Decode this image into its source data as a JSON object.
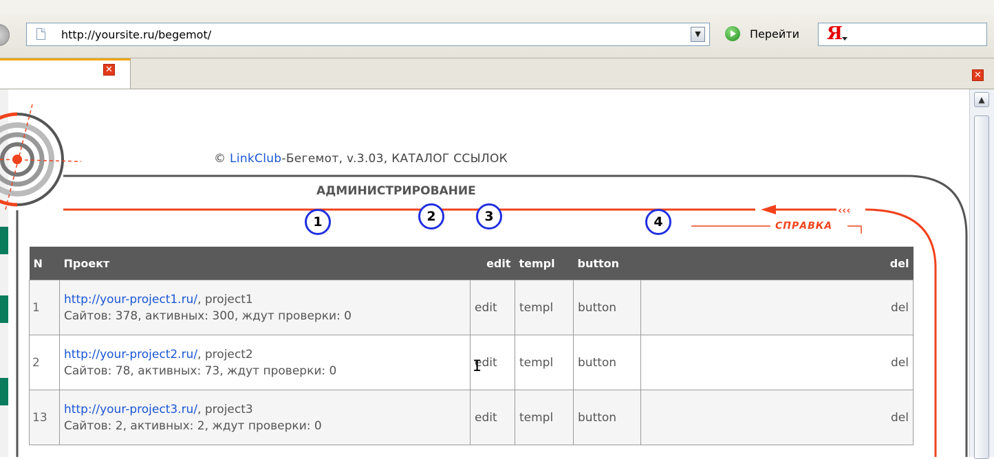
{
  "browser": {
    "address": "http://yoursite.ru/begemot/",
    "go_label": "Перейти",
    "search_logo": "Я",
    "tab_close": "✕",
    "window_close": "✕"
  },
  "page": {
    "copyright_symbol": "©",
    "brand_link": "LinkClub",
    "copyright_rest": "-Бегемот, v.3.03, КАТАЛОГ ССЫЛОК",
    "section_title": "АДМИНИСТРИРОВАНИЕ",
    "help_label": "СПРАВКА"
  },
  "callouts": [
    "1",
    "2",
    "3",
    "4"
  ],
  "table": {
    "headers": {
      "n": "N",
      "project": "Проект",
      "edit": "edit",
      "templ": "templ",
      "button": "button",
      "del": "del"
    },
    "rows": [
      {
        "n": "1",
        "url": "http://your-project1.ru/",
        "name": ", project1",
        "stats": "Сайтов: 378, активных: 300, ждут проверки: 0",
        "edit": "edit",
        "templ": "templ",
        "button": "button",
        "del": "del"
      },
      {
        "n": "2",
        "url": "http://your-project2.ru/",
        "name": ", project2",
        "stats": "Сайтов: 78, активных: 73, ждут проверки: 0",
        "edit": "edit",
        "templ": "templ",
        "button": "button",
        "del": "del"
      },
      {
        "n": "13",
        "url": "http://your-project3.ru/",
        "name": ", project3",
        "stats": "Сайтов: 2, активных: 2, ждут проверки: 0",
        "edit": "edit",
        "templ": "templ",
        "button": "button",
        "del": "del"
      }
    ]
  },
  "colors": {
    "accent_orange": "#f0431d",
    "link_blue": "#1a56d6",
    "callout_blue": "#1f2fe0",
    "header_gray": "#5a5a5a"
  }
}
